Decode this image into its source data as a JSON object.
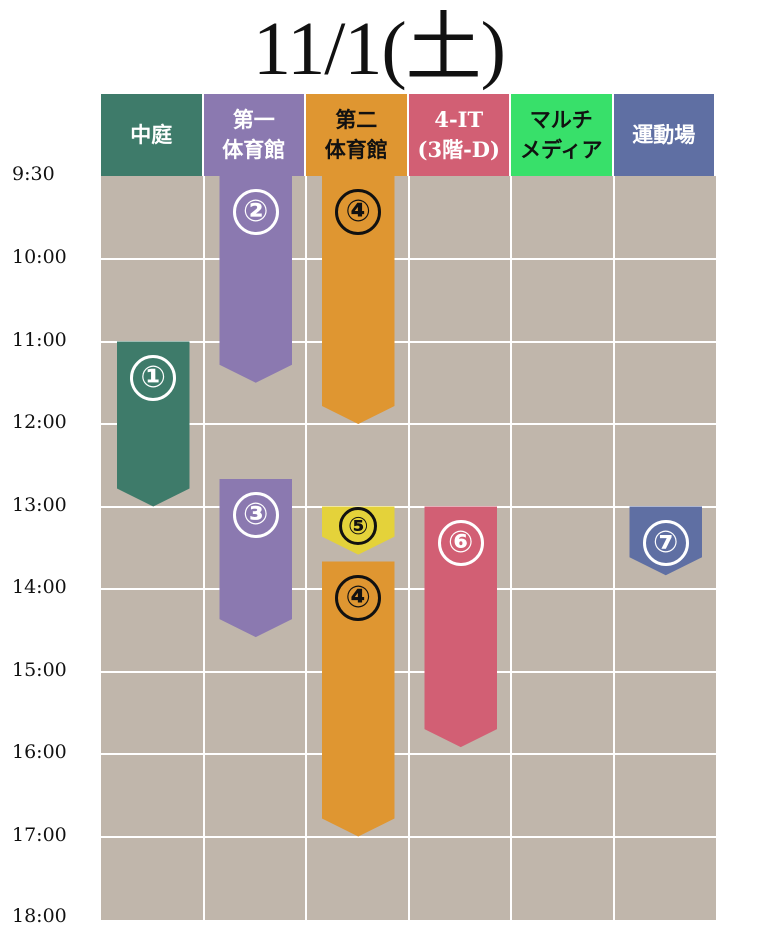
{
  "title": "11/1(土)",
  "venues": [
    {
      "label": "中庭",
      "bg": "#3e7b6a",
      "fg": "#ffffff"
    },
    {
      "label": "第一\n体育館",
      "bg": "#8b79b0",
      "fg": "#ffffff"
    },
    {
      "label": "第二\n体育館",
      "bg": "#df9631",
      "fg": "#111111"
    },
    {
      "label": "4-IT\n(3階-D)",
      "bg": "#d25f74",
      "fg": "#ffffff"
    },
    {
      "label": "マルチ\nメディア",
      "bg": "#38e06a",
      "fg": "#111111"
    },
    {
      "label": "運動場",
      "bg": "#5f6fa3",
      "fg": "#ffffff"
    }
  ],
  "time_labels": [
    "9:30",
    "10:00",
    "11:00",
    "12:00",
    "13:00",
    "14:00",
    "15:00",
    "16:00",
    "17:00",
    "18:00"
  ],
  "events": [
    {
      "number": "①",
      "venue_index": 0,
      "start": "11:00",
      "end": "13:00",
      "color": "#3e7b6a",
      "label_color": "white"
    },
    {
      "number": "②",
      "venue_index": 1,
      "start": "9:30",
      "end": "11:30",
      "color": "#8b79b0",
      "label_color": "white"
    },
    {
      "number": "③",
      "venue_index": 1,
      "start": "12:40",
      "end": "14:35",
      "color": "#8b79b0",
      "label_color": "white"
    },
    {
      "number": "④",
      "venue_index": 2,
      "start": "9:30",
      "end": "12:00",
      "color": "#df9631",
      "label_color": "dark"
    },
    {
      "number": "⑤",
      "venue_index": 2,
      "start": "13:00",
      "end": "13:35",
      "color": "#e4d23a",
      "label_color": "dark"
    },
    {
      "number": "④",
      "venue_index": 2,
      "start": "13:40",
      "end": "17:00",
      "color": "#df9631",
      "label_color": "dark"
    },
    {
      "number": "⑥",
      "venue_index": 3,
      "start": "13:00",
      "end": "15:55",
      "color": "#d25f74",
      "label_color": "white"
    },
    {
      "number": "⑦",
      "venue_index": 5,
      "start": "13:00",
      "end": "13:50",
      "color": "#5f6fa3",
      "label_color": "white"
    }
  ]
}
